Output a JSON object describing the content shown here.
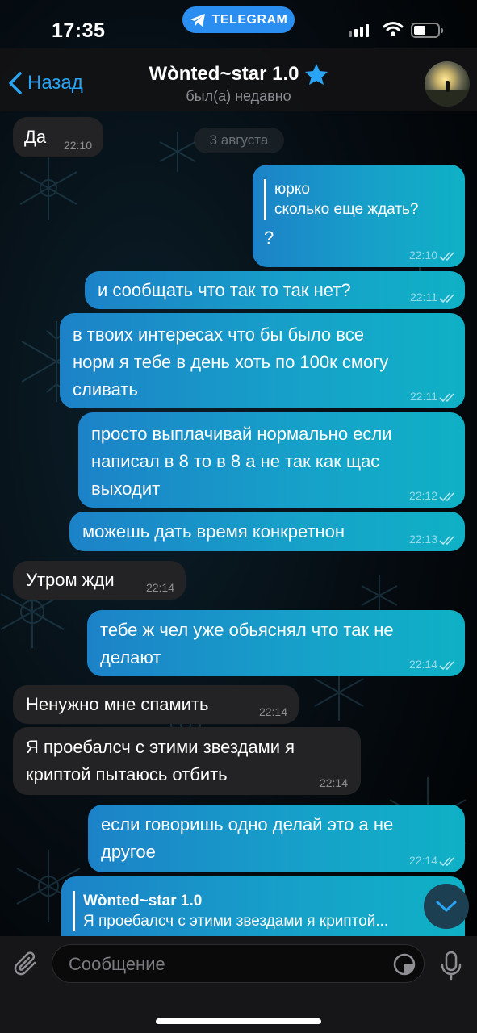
{
  "status_bar": {
    "time": "17:35",
    "app_label": "TELEGRAM"
  },
  "header": {
    "back_label": "Назад",
    "title": "Wònted~star 1.0",
    "subtitle": "был(а) недавно"
  },
  "date_chip": "3 августа",
  "messages": [
    {
      "dir": "in",
      "text": "Да",
      "time": "22:10"
    },
    {
      "dir": "out",
      "reply_author": "юрко",
      "reply_text": "сколько еще ждать?",
      "text": "?",
      "time": "22:10"
    },
    {
      "dir": "out",
      "text": "и сообщать что так то так нет?",
      "time": "22:11"
    },
    {
      "dir": "out",
      "line1": "в твоих интересах что бы было все",
      "line2": "норм я тебе в день хоть по 100к смогу",
      "line3": "сливать",
      "time": "22:11"
    },
    {
      "dir": "out",
      "line1": "просто выплачивай нормально если",
      "line2": "написал в 8 то в 8 а не так как щас",
      "line3": "выходит",
      "time": "22:12"
    },
    {
      "dir": "out",
      "text": "можешь дать время конкретнон",
      "time": "22:13"
    },
    {
      "dir": "in",
      "text": "Утром жди",
      "time": "22:14"
    },
    {
      "dir": "out",
      "line1": "тебе ж чел уже обьяснял что так не",
      "line2": "делают",
      "time": "22:14"
    },
    {
      "dir": "in",
      "text": "Ненужно мне спамить",
      "time": "22:14"
    },
    {
      "dir": "in",
      "line1": "Я проебалсч с этими звездами я",
      "line2": "криптой пытаюсь отбить",
      "time": "22:14"
    },
    {
      "dir": "out",
      "line1": "если говоришь одно делай это а не",
      "line2": "другое",
      "time": "22:14"
    },
    {
      "dir": "out",
      "reply_author": "Wònted~star 1.0",
      "reply_text": "Я проебалсч с этими звездами я криптой..."
    }
  ],
  "composer": {
    "placeholder": "Сообщение"
  },
  "colors": {
    "accent": "#2aa4f4",
    "bubble_out_start": "#1c82c8",
    "bubble_out_end": "#0fb1c6",
    "bubble_in": "#232325"
  }
}
